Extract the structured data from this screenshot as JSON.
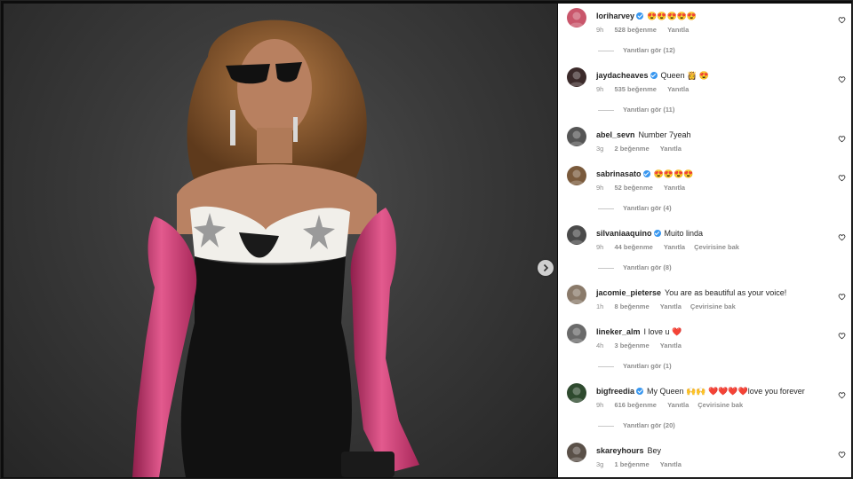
{
  "post": {
    "image": {
      "description_icon": "photo-woman-black-dress-pink-gloves-icon"
    },
    "next_button_icon": "chevron-right-icon"
  },
  "comments": [
    {
      "username": "loriharvey",
      "verified": true,
      "text": "😍😍😍😍😍",
      "time": "9h",
      "likes": "528 beğenme",
      "reply": "Yanıtla",
      "translate": "",
      "view_replies": "Yanıtları gör (12)",
      "avatar_color": "#c9566b"
    },
    {
      "username": "jaydacheaves",
      "verified": true,
      "text": "Queen 👸 😍",
      "time": "9h",
      "likes": "535 beğenme",
      "reply": "Yanıtla",
      "translate": "",
      "view_replies": "Yanıtları gör (11)",
      "avatar_color": "#3b2a2a"
    },
    {
      "username": "abel_sevn",
      "verified": false,
      "text": "Number 7yeah",
      "time": "3g",
      "likes": "2 beğenme",
      "reply": "Yanıtla",
      "translate": "",
      "view_replies": "",
      "avatar_color": "#555555"
    },
    {
      "username": "sabrinasato",
      "verified": true,
      "text": "😍😍😍😍",
      "time": "9h",
      "likes": "52 beğenme",
      "reply": "Yanıtla",
      "translate": "",
      "view_replies": "Yanıtları gör (4)",
      "avatar_color": "#7a5a3c"
    },
    {
      "username": "silvaniaaquino",
      "verified": true,
      "text": "Muito linda",
      "time": "9h",
      "likes": "44 beğenme",
      "reply": "Yanıtla",
      "translate": "Çevirisine bak",
      "view_replies": "Yanıtları gör (8)",
      "avatar_color": "#4a4a4a"
    },
    {
      "username": "jacomie_pieterse",
      "verified": false,
      "text": "You are as beautiful as your voice!",
      "time": "1h",
      "likes": "8 beğenme",
      "reply": "Yanıtla",
      "translate": "Çevirisine bak",
      "view_replies": "",
      "avatar_color": "#8a7a6a"
    },
    {
      "username": "lineker_alm",
      "verified": false,
      "text": "I love u ❤️",
      "time": "4h",
      "likes": "3 beğenme",
      "reply": "Yanıtla",
      "translate": "",
      "view_replies": "Yanıtları gör (1)",
      "avatar_color": "#6a6a6a"
    },
    {
      "username": "bigfreedia",
      "verified": true,
      "text": "My Queen 🙌🙌 ❤️❤️❤️❤️love you forever",
      "time": "9h",
      "likes": "616 beğenme",
      "reply": "Yanıtla",
      "translate": "Çevirisine bak",
      "view_replies": "Yanıtları gör (20)",
      "avatar_color": "#2e4a2e"
    },
    {
      "username": "skareyhours",
      "verified": false,
      "text": "Bey",
      "time": "3g",
      "likes": "1 beğenme",
      "reply": "Yanıtla",
      "translate": "",
      "view_replies": "",
      "avatar_color": "#5a5048"
    }
  ],
  "colors": {
    "verified": "#3897f0",
    "meta": "#8e8e8e",
    "text": "#262626"
  }
}
